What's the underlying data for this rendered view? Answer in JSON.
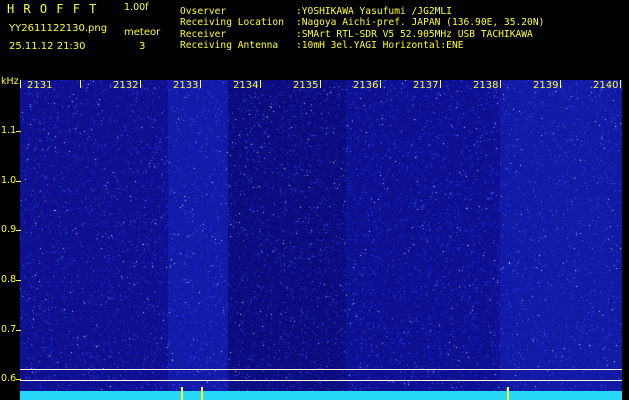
{
  "app": {
    "title": "HROFFT",
    "version": "1.00f",
    "file_name": "YY2611122130.png",
    "timestamp": "25.11.12 21:30",
    "meteor_label": "meteor",
    "meteor_count": "3"
  },
  "station": {
    "labels": [
      "Ovserver",
      "Receiving Location",
      "Receiver",
      "Receiving Antenna"
    ],
    "values": [
      ":YOSHIKAWA Yasufumi /JG2MLI",
      ":Nagoya Aichi-pref. JAPAN (136.90E, 35.20N)",
      ":SMArt RTL-SDR V5 52.905MHz USB TACHIKAWA",
      ":10mH 3el.YAGI Horizontal:ENE"
    ]
  },
  "spectrogram": {
    "unit": "kHz",
    "time_labels": [
      "2131",
      "2132",
      "2133",
      "2134",
      "2135",
      "2136",
      "2137",
      "2138",
      "2139",
      "2140"
    ],
    "freq_labels": [
      "1.1",
      "1.0",
      "0.9",
      "0.8",
      "0.7",
      "0.6"
    ],
    "colors": {
      "background": "#000000",
      "text": "#ffff2e",
      "noise_dark": "#0a0a72",
      "noise_bright": "#1a2ad8",
      "baseline": "#28d8f8"
    }
  }
}
